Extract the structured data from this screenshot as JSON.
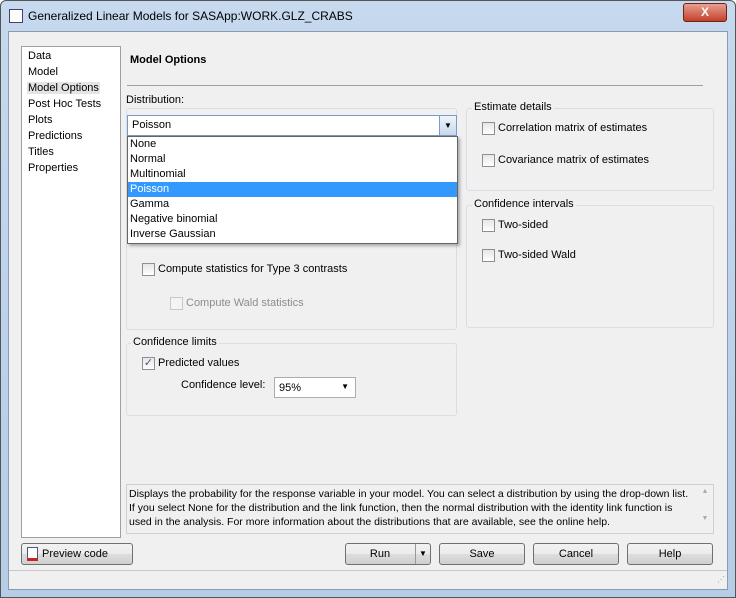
{
  "window": {
    "title": "Generalized Linear Models for SASApp:WORK.GLZ_CRABS",
    "close_label": "X"
  },
  "nav": {
    "items": [
      "Data",
      "Model",
      "Model Options",
      "Post Hoc Tests",
      "Plots",
      "Predictions",
      "Titles",
      "Properties"
    ],
    "selected": "Model Options"
  },
  "main": {
    "heading": "Model Options",
    "distribution": {
      "label": "Distribution:",
      "value": "Poisson",
      "options": [
        "None",
        "Normal",
        "Multinomial",
        "Poisson",
        "Gamma",
        "Negative binomial",
        "Inverse Gaussian"
      ],
      "selected_index": 3
    },
    "type3": {
      "label": "Compute statistics for Type 3 contrasts",
      "checked": false
    },
    "wald": {
      "label": "Compute Wald statistics",
      "checked": false,
      "disabled": true
    },
    "confidence_limits": {
      "title": "Confidence limits",
      "predicted": {
        "label": "Predicted values",
        "checked": true
      },
      "level_label": "Confidence level:",
      "level_value": "95%"
    },
    "estimate_details": {
      "title": "Estimate details",
      "correlation": "Correlation matrix of estimates",
      "covariance": "Covariance matrix of estimates"
    },
    "confidence_intervals": {
      "title": "Confidence intervals",
      "two_sided": "Two-sided",
      "two_sided_wald": "Two-sided Wald"
    },
    "help_text": "Displays the probability for the response variable in your model.  You can select a distribution by using the drop-down list.  If you select None for the distribution and the link function, then the normal distribution with the identity link function is used in the analysis. For more information about the distributions that are available, see the online help."
  },
  "buttons": {
    "preview": "Preview code",
    "run": "Run",
    "save": "Save",
    "cancel": "Cancel",
    "help": "Help"
  },
  "colors": {
    "selection": "#3399ff",
    "background": "#f0f0f0"
  }
}
